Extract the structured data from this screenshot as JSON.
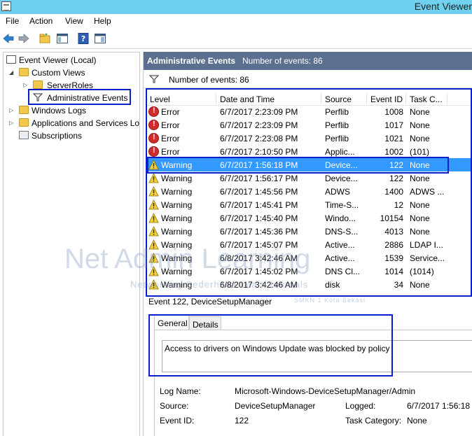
{
  "window": {
    "title": "Event Viewer"
  },
  "menu": [
    "File",
    "Action",
    "View",
    "Help"
  ],
  "toolbar": {
    "icons": [
      "back-arrow-icon",
      "forward-arrow-icon",
      "open-folder-icon",
      "show-hide-tree-icon",
      "help-icon",
      "action-pane-icon"
    ]
  },
  "tree": {
    "root": "Event Viewer (Local)",
    "custom_views": "Custom Views",
    "server_roles": "ServerRoles",
    "administrative_events": "Administrative Events",
    "windows_logs": "Windows Logs",
    "apps_services": "Applications and Services Lo",
    "subscriptions": "Subscriptions"
  },
  "pane": {
    "title": "Administrative Events",
    "count_label": "Number of events: 86"
  },
  "filter": {
    "label": "Number of events: 86"
  },
  "grid": {
    "columns": [
      "Level",
      "Date and Time",
      "Source",
      "Event ID",
      "Task C..."
    ],
    "rows": [
      {
        "level": "Error",
        "date": "6/7/2017 2:23:09 PM",
        "source": "Perflib",
        "id": "1008",
        "task": "None"
      },
      {
        "level": "Error",
        "date": "6/7/2017 2:23:09 PM",
        "source": "Perflib",
        "id": "1017",
        "task": "None"
      },
      {
        "level": "Error",
        "date": "6/7/2017 2:23:08 PM",
        "source": "Perflib",
        "id": "1021",
        "task": "None"
      },
      {
        "level": "Error",
        "date": "6/7/2017 2:10:50 PM",
        "source": "Applic...",
        "id": "1002",
        "task": "(101)"
      },
      {
        "level": "Warning",
        "date": "6/7/2017 1:56:18 PM",
        "source": "Device...",
        "id": "122",
        "task": "None"
      },
      {
        "level": "Warning",
        "date": "6/7/2017 1:56:17 PM",
        "source": "Device...",
        "id": "122",
        "task": "None"
      },
      {
        "level": "Warning",
        "date": "6/7/2017 1:45:56 PM",
        "source": "ADWS",
        "id": "1400",
        "task": "ADWS ..."
      },
      {
        "level": "Warning",
        "date": "6/7/2017 1:45:41 PM",
        "source": "Time-S...",
        "id": "12",
        "task": "None"
      },
      {
        "level": "Warning",
        "date": "6/7/2017 1:45:40 PM",
        "source": "Windo...",
        "id": "10154",
        "task": "None"
      },
      {
        "level": "Warning",
        "date": "6/7/2017 1:45:36 PM",
        "source": "DNS-S...",
        "id": "4013",
        "task": "None"
      },
      {
        "level": "Warning",
        "date": "6/7/2017 1:45:07 PM",
        "source": "Active...",
        "id": "2886",
        "task": "LDAP I..."
      },
      {
        "level": "Warning",
        "date": "6/8/2017 3:42:46 AM",
        "source": "Active...",
        "id": "1539",
        "task": "Service..."
      },
      {
        "level": "Warning",
        "date": "6/7/2017 1:45:02 PM",
        "source": "DNS Cl...",
        "id": "1014",
        "task": "(1014)"
      },
      {
        "level": "Warning",
        "date": "6/8/2017 3:42:46 AM",
        "source": "disk",
        "id": "34",
        "task": "None"
      }
    ],
    "selected_index": 4
  },
  "event": {
    "title": "Event 122, DeviceSetupManager"
  },
  "tabs": [
    "General",
    "Details"
  ],
  "general": {
    "message": "Access to drivers on Windows Update was blocked by policy",
    "log_name_label": "Log Name:",
    "log_name": "Microsoft-Windows-DeviceSetupManager/Admin",
    "source_label": "Source:",
    "source": "DeviceSetupManager",
    "logged_label": "Logged:",
    "logged": "6/7/2017 1:56:18 P",
    "event_id_label": "Event ID:",
    "event_id": "122",
    "task_category_label": "Task Category:",
    "task_category": "None"
  },
  "watermark": {
    "brand": "Net Admin Learning",
    "site": "Networking.Sederhana.Learn.tutorials",
    "school": "SMKN 1 Kota Bekasi"
  },
  "colors": {
    "titlebar": "#6fd0ef",
    "pane_header": "#5b6f8e",
    "selection": "#3399ff",
    "annotation": "#0a1ecc"
  }
}
